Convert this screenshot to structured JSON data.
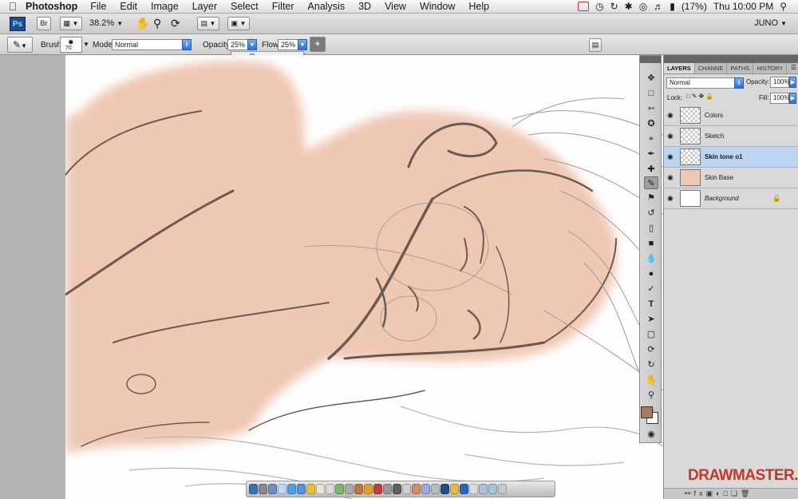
{
  "menubar": {
    "app_name": "Photoshop",
    "items": [
      "File",
      "Edit",
      "Image",
      "Layer",
      "Select",
      "Filter",
      "Analysis",
      "3D",
      "View",
      "Window",
      "Help"
    ],
    "battery": "(17%)",
    "clock": "Thu 10:00 PM"
  },
  "appbar": {
    "ps_label": "Ps",
    "br_label": "Br",
    "zoom": "38.2%",
    "workspace": "JUNO"
  },
  "options": {
    "brush_label": "Brush:",
    "brush_size": "70",
    "mode_label": "Mode:",
    "mode_value": "Normal",
    "opacity_label": "Opacity:",
    "opacity_value": "25%",
    "flow_label": "Flow:",
    "flow_value": "25%",
    "opacity_slider_fraction": 0.25
  },
  "layers_panel": {
    "tabs": [
      "LAYERS",
      "CHANNE",
      "PATHS",
      "HISTORY"
    ],
    "blend_mode": "Normal",
    "opacity_label": "Opacity:",
    "opacity_value": "100%",
    "lock_label": "Lock:",
    "fill_label": "Fill:",
    "fill_value": "100%",
    "layers": [
      {
        "name": "Colors",
        "visible": true,
        "selected": false
      },
      {
        "name": "Sketch",
        "visible": true,
        "selected": false
      },
      {
        "name": "Skin tone o1",
        "visible": true,
        "selected": true
      },
      {
        "name": "Skin Base",
        "visible": true,
        "selected": false
      },
      {
        "name": "Background",
        "visible": true,
        "selected": false,
        "locked": true
      }
    ]
  },
  "colors": {
    "foreground": "#a67a5e",
    "background": "#ffffff",
    "skin": "#efc8b4"
  },
  "watermark": "DRAWMASTER.RU"
}
